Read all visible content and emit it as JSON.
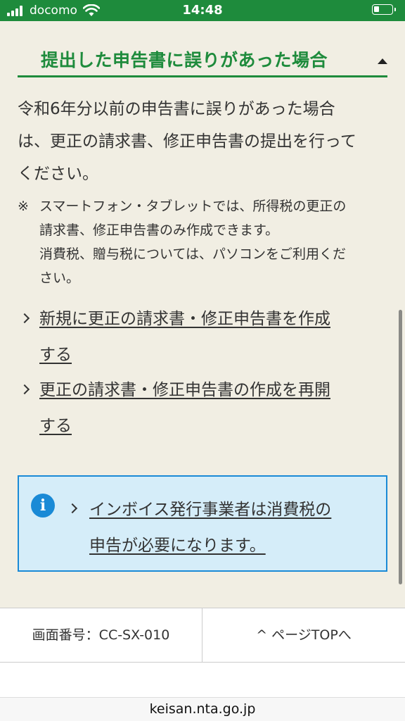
{
  "status_bar": {
    "carrier": "docomo",
    "time": "14:48"
  },
  "section": {
    "title": "提出した申告書に誤りがあった場合",
    "intro_lines": [
      "令和6年分以前の申告書に誤りがあった場合",
      "は、更正の請求書、修正申告書の提出を行って",
      "ください。"
    ],
    "note_mark": "※",
    "note_lines": [
      "スマートフォン・タブレットでは、所得税の更正の",
      "請求書、修正申告書のみ作成できます。",
      "消費税、贈与税については、パソコンをご利用くだ",
      "さい。"
    ],
    "links": [
      {
        "lines": [
          "新規に更正の請求書・修正申告書を作成",
          "する"
        ]
      },
      {
        "lines": [
          "更正の請求書・修正申告書の作成を再開",
          "する"
        ]
      }
    ]
  },
  "info_box": {
    "icon_letter": "i",
    "link_lines": [
      "インボイス発行事業者は消費税の",
      "申告が必要になります。"
    ]
  },
  "footer": {
    "screen_id": "画面番号：CC-SX-010",
    "page_top": "^ ページTOPへ"
  },
  "browser": {
    "url": "keisan.nta.go.jp"
  },
  "colors": {
    "accent_green": "#1e8b3c",
    "info_blue": "#1a8ad6",
    "info_bg": "#d5edf9",
    "page_bg": "#f1eee3"
  }
}
